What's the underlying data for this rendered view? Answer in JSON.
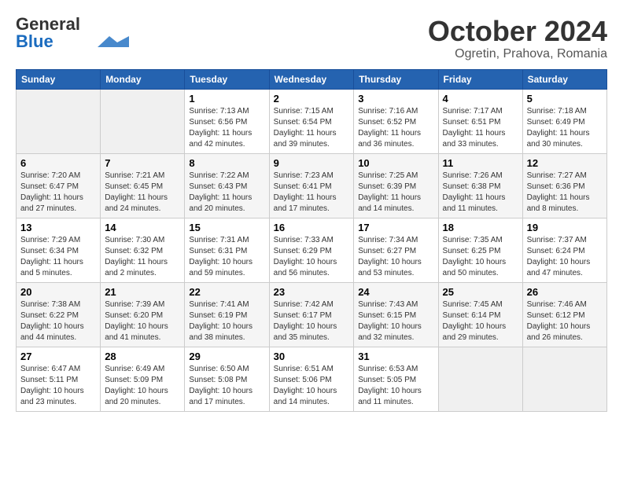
{
  "header": {
    "logo_general": "General",
    "logo_blue": "Blue",
    "month": "October 2024",
    "location": "Ogretin, Prahova, Romania"
  },
  "weekdays": [
    "Sunday",
    "Monday",
    "Tuesday",
    "Wednesday",
    "Thursday",
    "Friday",
    "Saturday"
  ],
  "weeks": [
    [
      {
        "day": "",
        "empty": true
      },
      {
        "day": "",
        "empty": true
      },
      {
        "day": "1",
        "sunrise": "Sunrise: 7:13 AM",
        "sunset": "Sunset: 6:56 PM",
        "daylight": "Daylight: 11 hours and 42 minutes."
      },
      {
        "day": "2",
        "sunrise": "Sunrise: 7:15 AM",
        "sunset": "Sunset: 6:54 PM",
        "daylight": "Daylight: 11 hours and 39 minutes."
      },
      {
        "day": "3",
        "sunrise": "Sunrise: 7:16 AM",
        "sunset": "Sunset: 6:52 PM",
        "daylight": "Daylight: 11 hours and 36 minutes."
      },
      {
        "day": "4",
        "sunrise": "Sunrise: 7:17 AM",
        "sunset": "Sunset: 6:51 PM",
        "daylight": "Daylight: 11 hours and 33 minutes."
      },
      {
        "day": "5",
        "sunrise": "Sunrise: 7:18 AM",
        "sunset": "Sunset: 6:49 PM",
        "daylight": "Daylight: 11 hours and 30 minutes."
      }
    ],
    [
      {
        "day": "6",
        "sunrise": "Sunrise: 7:20 AM",
        "sunset": "Sunset: 6:47 PM",
        "daylight": "Daylight: 11 hours and 27 minutes."
      },
      {
        "day": "7",
        "sunrise": "Sunrise: 7:21 AM",
        "sunset": "Sunset: 6:45 PM",
        "daylight": "Daylight: 11 hours and 24 minutes."
      },
      {
        "day": "8",
        "sunrise": "Sunrise: 7:22 AM",
        "sunset": "Sunset: 6:43 PM",
        "daylight": "Daylight: 11 hours and 20 minutes."
      },
      {
        "day": "9",
        "sunrise": "Sunrise: 7:23 AM",
        "sunset": "Sunset: 6:41 PM",
        "daylight": "Daylight: 11 hours and 17 minutes."
      },
      {
        "day": "10",
        "sunrise": "Sunrise: 7:25 AM",
        "sunset": "Sunset: 6:39 PM",
        "daylight": "Daylight: 11 hours and 14 minutes."
      },
      {
        "day": "11",
        "sunrise": "Sunrise: 7:26 AM",
        "sunset": "Sunset: 6:38 PM",
        "daylight": "Daylight: 11 hours and 11 minutes."
      },
      {
        "day": "12",
        "sunrise": "Sunrise: 7:27 AM",
        "sunset": "Sunset: 6:36 PM",
        "daylight": "Daylight: 11 hours and 8 minutes."
      }
    ],
    [
      {
        "day": "13",
        "sunrise": "Sunrise: 7:29 AM",
        "sunset": "Sunset: 6:34 PM",
        "daylight": "Daylight: 11 hours and 5 minutes."
      },
      {
        "day": "14",
        "sunrise": "Sunrise: 7:30 AM",
        "sunset": "Sunset: 6:32 PM",
        "daylight": "Daylight: 11 hours and 2 minutes."
      },
      {
        "day": "15",
        "sunrise": "Sunrise: 7:31 AM",
        "sunset": "Sunset: 6:31 PM",
        "daylight": "Daylight: 10 hours and 59 minutes."
      },
      {
        "day": "16",
        "sunrise": "Sunrise: 7:33 AM",
        "sunset": "Sunset: 6:29 PM",
        "daylight": "Daylight: 10 hours and 56 minutes."
      },
      {
        "day": "17",
        "sunrise": "Sunrise: 7:34 AM",
        "sunset": "Sunset: 6:27 PM",
        "daylight": "Daylight: 10 hours and 53 minutes."
      },
      {
        "day": "18",
        "sunrise": "Sunrise: 7:35 AM",
        "sunset": "Sunset: 6:25 PM",
        "daylight": "Daylight: 10 hours and 50 minutes."
      },
      {
        "day": "19",
        "sunrise": "Sunrise: 7:37 AM",
        "sunset": "Sunset: 6:24 PM",
        "daylight": "Daylight: 10 hours and 47 minutes."
      }
    ],
    [
      {
        "day": "20",
        "sunrise": "Sunrise: 7:38 AM",
        "sunset": "Sunset: 6:22 PM",
        "daylight": "Daylight: 10 hours and 44 minutes."
      },
      {
        "day": "21",
        "sunrise": "Sunrise: 7:39 AM",
        "sunset": "Sunset: 6:20 PM",
        "daylight": "Daylight: 10 hours and 41 minutes."
      },
      {
        "day": "22",
        "sunrise": "Sunrise: 7:41 AM",
        "sunset": "Sunset: 6:19 PM",
        "daylight": "Daylight: 10 hours and 38 minutes."
      },
      {
        "day": "23",
        "sunrise": "Sunrise: 7:42 AM",
        "sunset": "Sunset: 6:17 PM",
        "daylight": "Daylight: 10 hours and 35 minutes."
      },
      {
        "day": "24",
        "sunrise": "Sunrise: 7:43 AM",
        "sunset": "Sunset: 6:15 PM",
        "daylight": "Daylight: 10 hours and 32 minutes."
      },
      {
        "day": "25",
        "sunrise": "Sunrise: 7:45 AM",
        "sunset": "Sunset: 6:14 PM",
        "daylight": "Daylight: 10 hours and 29 minutes."
      },
      {
        "day": "26",
        "sunrise": "Sunrise: 7:46 AM",
        "sunset": "Sunset: 6:12 PM",
        "daylight": "Daylight: 10 hours and 26 minutes."
      }
    ],
    [
      {
        "day": "27",
        "sunrise": "Sunrise: 6:47 AM",
        "sunset": "Sunset: 5:11 PM",
        "daylight": "Daylight: 10 hours and 23 minutes."
      },
      {
        "day": "28",
        "sunrise": "Sunrise: 6:49 AM",
        "sunset": "Sunset: 5:09 PM",
        "daylight": "Daylight: 10 hours and 20 minutes."
      },
      {
        "day": "29",
        "sunrise": "Sunrise: 6:50 AM",
        "sunset": "Sunset: 5:08 PM",
        "daylight": "Daylight: 10 hours and 17 minutes."
      },
      {
        "day": "30",
        "sunrise": "Sunrise: 6:51 AM",
        "sunset": "Sunset: 5:06 PM",
        "daylight": "Daylight: 10 hours and 14 minutes."
      },
      {
        "day": "31",
        "sunrise": "Sunrise: 6:53 AM",
        "sunset": "Sunset: 5:05 PM",
        "daylight": "Daylight: 10 hours and 11 minutes."
      },
      {
        "day": "",
        "empty": true
      },
      {
        "day": "",
        "empty": true
      }
    ]
  ]
}
